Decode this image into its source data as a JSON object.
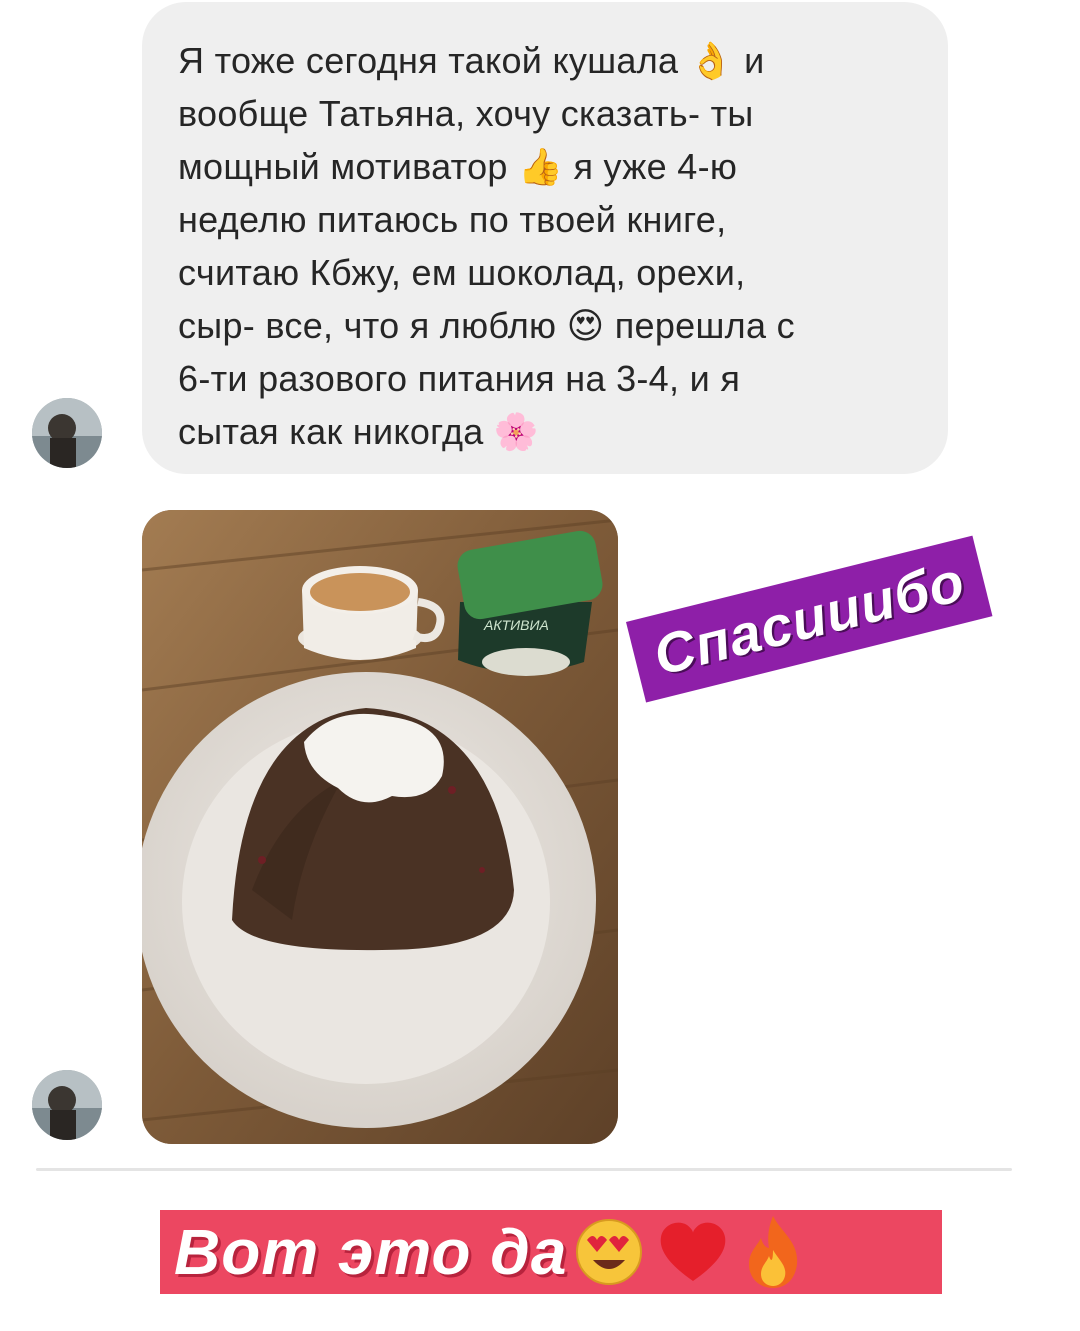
{
  "message": {
    "text": "Я тоже сегодня такой кушала 👌 и\nвообще Татьяна, хочу сказать- ты\nмощный мотиватор 👍 я уже 4-ю\nнеделю питаюсь по твоей книге,\nсчитаю Кбжу, ем шоколад, орехи,\nсыр- все, что я люблю 😍 перешла с\n6-ти разового питания на 3-4, и я\nсытая как никогда 🌸"
  },
  "photo": {
    "brand_label": "АКТИВИА",
    "description_icon": "photo-icon"
  },
  "stickers": {
    "thanks": "Спасииибо",
    "wow": "Вот это да",
    "wow_emojis": [
      "heart-eyes-emoji",
      "red-heart-emoji",
      "fire-emoji"
    ]
  },
  "colors": {
    "bubble_bg": "#efefef",
    "thanks_bg": "#8e1fa8",
    "wow_bg": "#ec4761"
  }
}
